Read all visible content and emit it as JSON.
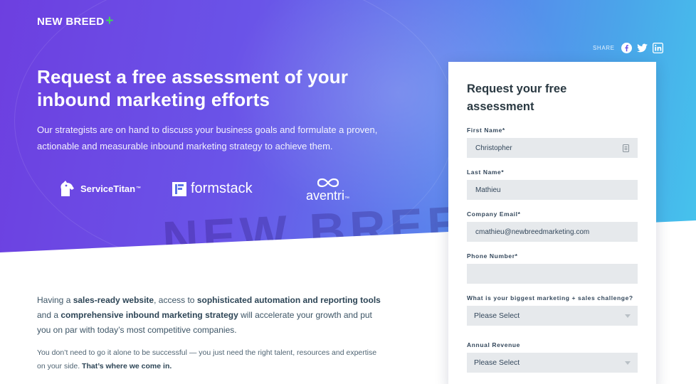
{
  "brand": {
    "name": "NEW BREED",
    "plus": "+"
  },
  "share": {
    "label": "SHARE",
    "icons": [
      "facebook-icon",
      "twitter-icon",
      "linkedin-icon"
    ]
  },
  "hero": {
    "title": "Request a free assessment of your inbound marketing efforts",
    "subtitle": "Our strategists are on hand to discuss your business goals and formulate a proven, actionable and measurable inbound marketing strategy to achieve them.",
    "watermark": "NEW BREED +"
  },
  "clients": [
    {
      "name": "ServiceTitan",
      "tm": "™"
    },
    {
      "name": "formstack"
    },
    {
      "name": "aventri",
      "tm": "™"
    }
  ],
  "body": {
    "p1_a": "Having a ",
    "p1_b": "sales-ready website",
    "p1_c": ", access to ",
    "p1_d": "sophisticated automation and reporting tools",
    "p1_e": " and a ",
    "p1_f": "comprehensive inbound marketing strategy",
    "p1_g": " will accelerate your growth and put you on par with today’s most competitive companies.",
    "p2_a": "You don’t need to go it alone to be successful — you just need the right talent, resources and expertise on your side. ",
    "p2_b": "That’s where we come in."
  },
  "form": {
    "title": "Request your free assessment",
    "first_name": {
      "label": "First Name*",
      "value": "Christopher"
    },
    "last_name": {
      "label": "Last Name*",
      "value": "Mathieu"
    },
    "email": {
      "label": "Company Email*",
      "value": "cmathieu@newbreedmarketing.com"
    },
    "phone": {
      "label": "Phone Number*",
      "value": ""
    },
    "challenge": {
      "label": "What is your biggest marketing + sales challenge?",
      "value": "Please Select"
    },
    "revenue": {
      "label": "Annual Revenue",
      "value": "Please Select"
    }
  },
  "colors": {
    "accent_green": "#3fd35b",
    "hero_start": "#6d3fe0",
    "hero_end": "#45c4ec",
    "body_text": "#3d5566"
  }
}
